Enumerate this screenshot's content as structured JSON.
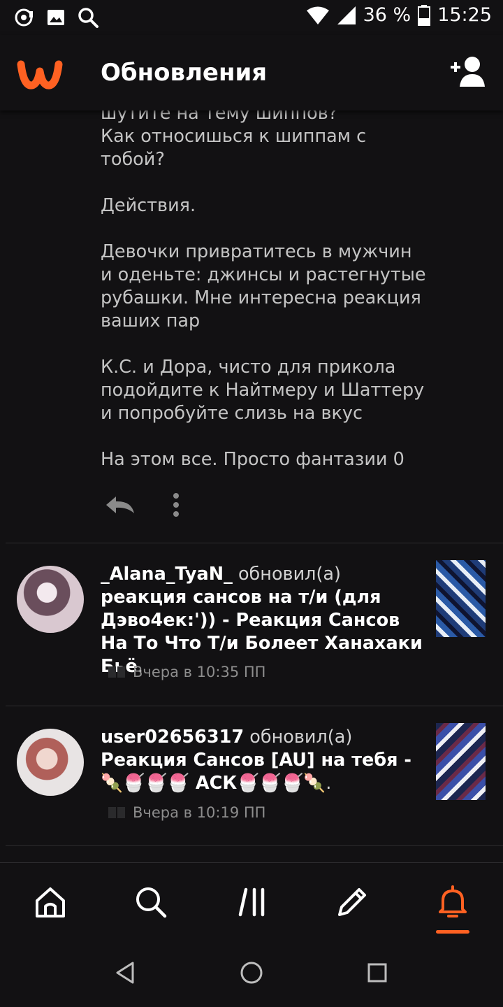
{
  "status_bar": {
    "icons": [
      "podcast-icon",
      "image-icon",
      "search-icon"
    ],
    "battery": "36 %",
    "time": "15:25"
  },
  "header": {
    "title": "Обновления",
    "logo": "wattpad-logo",
    "action_icon": "add-user-icon"
  },
  "message": {
    "text": "шутите на тему шиппов?\nКак относишься к шиппам с тобой?\n\nДействия.\n\nДевочки привратитесь в мужчин и оденьте: джинсы и растегнутые рубашки. Мне интересна реакция ваших пар\n\nК.С. и Дора, чисто для прикола подойдите к Найтмеру и Шаттеру и попробуйте слизь на вкус\n\nНа этом все. Просто фантазии 0",
    "actions": [
      "reply-icon",
      "more-icon"
    ]
  },
  "updates": [
    {
      "user": "_Alana_TyaN_",
      "verb": "обновил(а)",
      "story": "реакция сансов на т/и (для Дэво4ек:')) - Реакция Сансов На То Что Т/и Болеет Ханахаки Бьё",
      "end": ".",
      "time": "Вчера в 10:35 ПП"
    },
    {
      "user": "user02656317",
      "verb": "обновил(а)",
      "story": "Реакция Сансов [AU] на тебя - 🍡🍧🍧🍧 АСК🍧🍧🍧🍡",
      "end": ".",
      "time": "Вчера в 10:19 ПП"
    }
  ],
  "bottom_nav": {
    "items": [
      "home-icon",
      "search-icon",
      "library-icon",
      "write-icon",
      "notifications-icon"
    ],
    "active": "notifications-icon",
    "accent": "#ff6122"
  },
  "system_nav": [
    "back-icon",
    "home-circle-icon",
    "recents-icon"
  ],
  "colors": {
    "background": "#121113",
    "accent": "#ff6122",
    "muted_text": "#c4c4c4"
  }
}
